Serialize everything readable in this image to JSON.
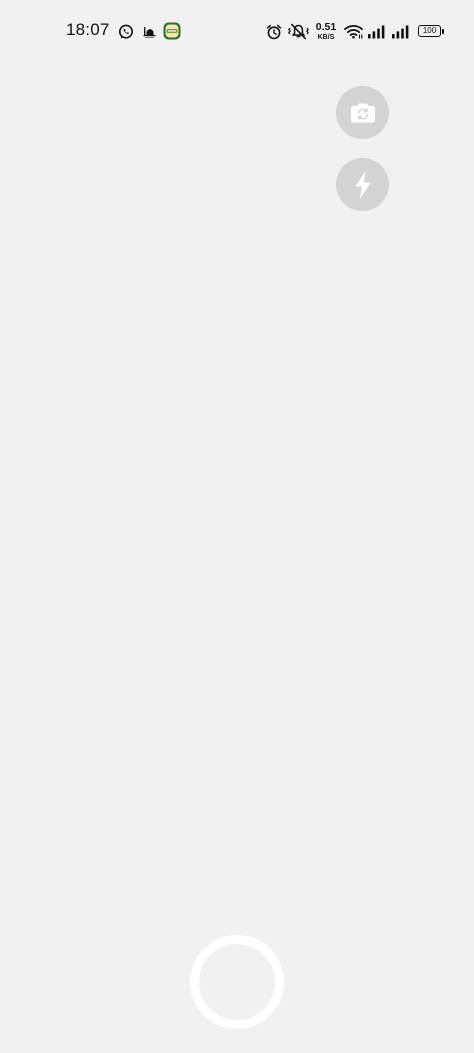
{
  "status_bar": {
    "time": "18:07",
    "net_speed_value": "0.51",
    "net_speed_unit": "KB/S",
    "battery_level": "100",
    "icons": {
      "notification_1": "whatsapp-icon",
      "notification_2": "mosque-icon",
      "notification_3": "app-badge-icon",
      "alarm": "alarm-icon",
      "mute": "vibrate-mute-icon",
      "wifi": "wifi-icon",
      "signal_1": "signal-bars-icon",
      "signal_2": "signal-bars-icon",
      "battery": "battery-icon"
    }
  },
  "camera": {
    "controls": {
      "switch_camera": "camera-switch-icon",
      "flash": "flash-icon",
      "shutter": "shutter-ring"
    }
  },
  "colors": {
    "background": "#f1f1f1",
    "control_bg": "#d4d4d4",
    "control_icon": "#ffffff",
    "shutter_ring": "#ffffff",
    "status_text": "#111111"
  }
}
